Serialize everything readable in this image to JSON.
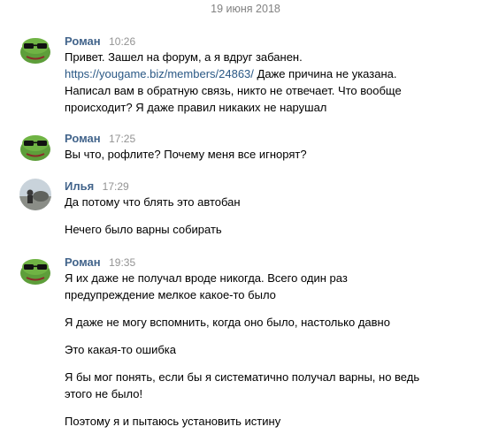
{
  "date_separator": "19 июня 2018",
  "messages": [
    {
      "author": "Роман",
      "time": "10:26",
      "avatar": "pepe-frog",
      "lines": [
        "Привет. Зашел на форум, а я вдруг забанен.",
        "Даже причина не указана.",
        "Написал вам в обратную связь, никто не отвечает. Что вообще",
        "происходит? Я даже правил никаких не нарушал"
      ],
      "link": "https://yougame.biz/members/24863/"
    },
    {
      "author": "Роман",
      "time": "17:25",
      "avatar": "pepe-frog",
      "lines": [
        "Вы что, рофлите? Почему меня все игнорят?"
      ]
    },
    {
      "author": "Илья",
      "time": "17:29",
      "avatar": "photo",
      "lines": [
        "Да потому что блять это автобан",
        "Нечего было варны собирать"
      ]
    },
    {
      "author": "Роман",
      "time": "19:35",
      "avatar": "pepe-frog",
      "lines": [
        "Я их даже не получал вроде никогда. Всего один раз",
        "предупреждение мелкое какое-то было",
        "Я даже не могу вспомнить, когда оно было, настолько давно",
        "Это какая-то ошибка",
        "Я бы мог понять, если бы я систематично получал варны, но ведь",
        "этого не было!",
        "Поэтому я и пытаюсь установить истину"
      ]
    }
  ]
}
